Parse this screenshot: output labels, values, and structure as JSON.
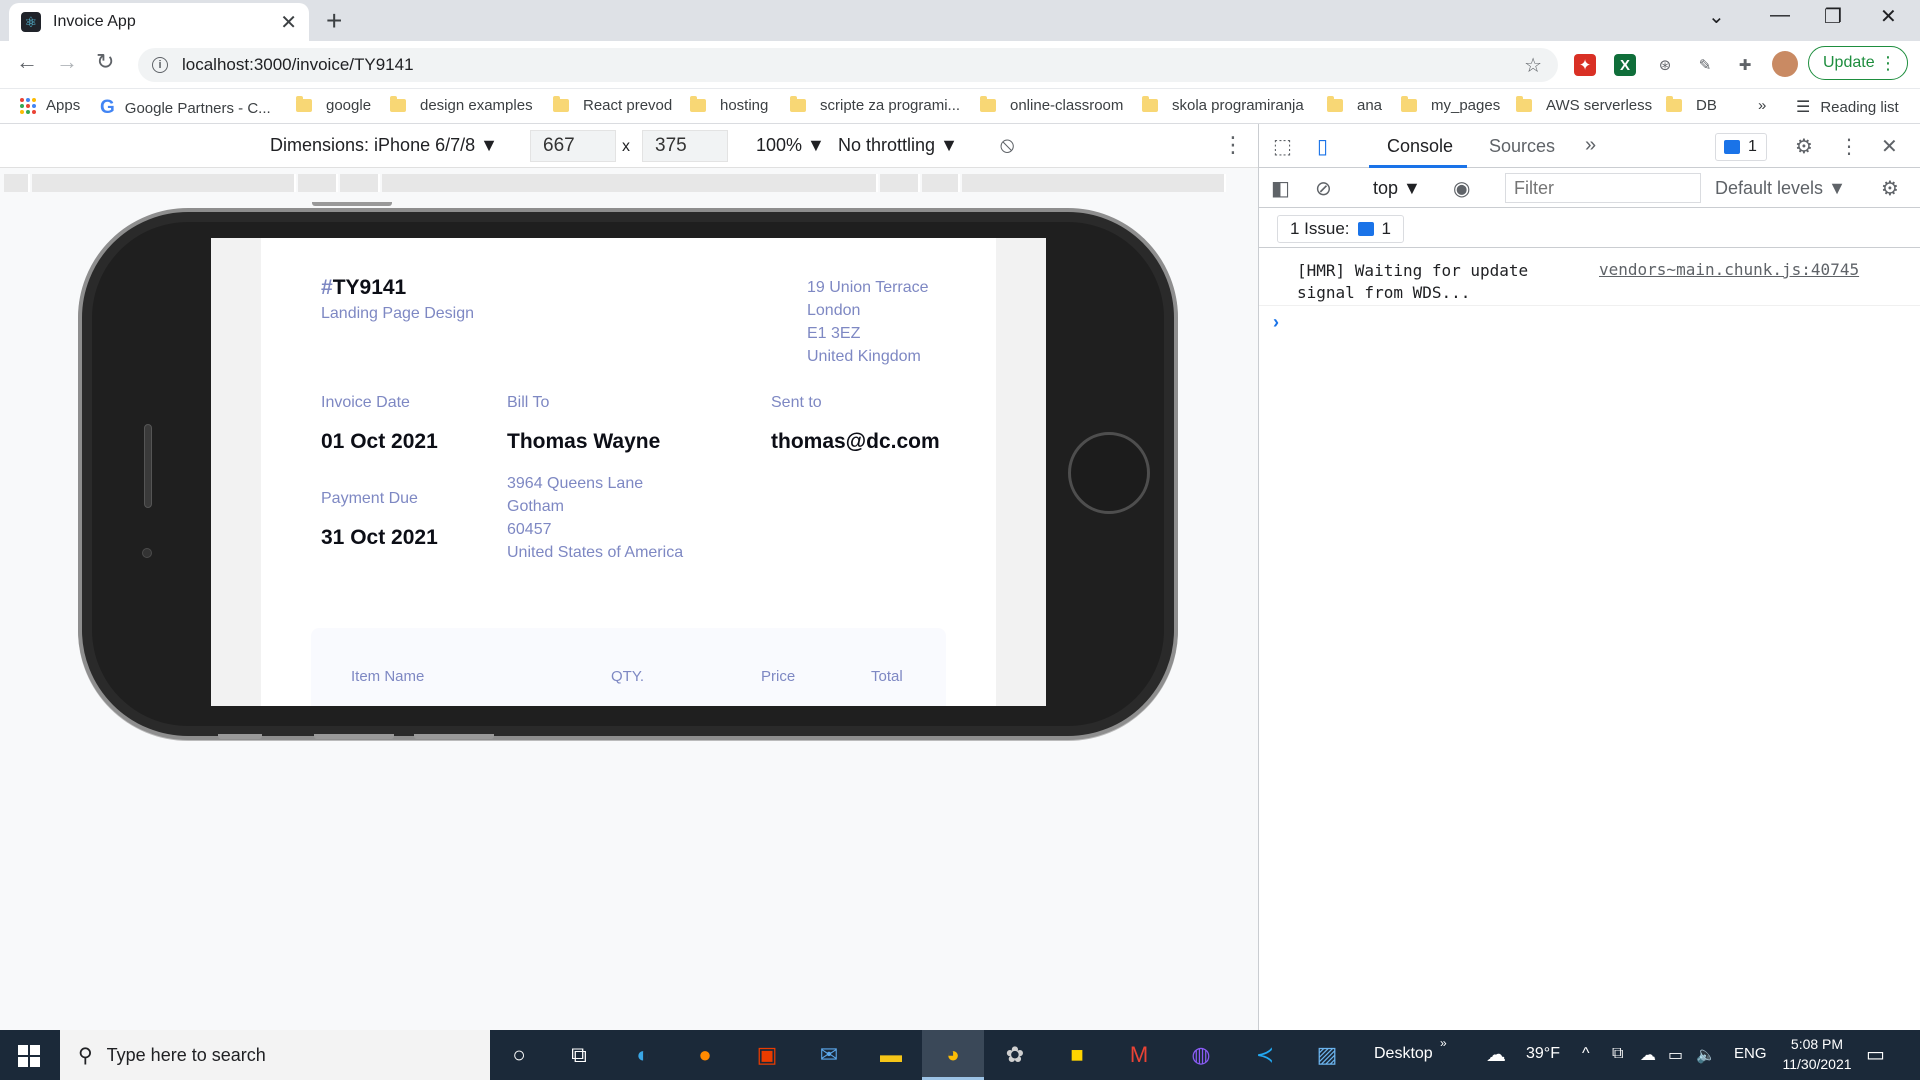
{
  "browser": {
    "tab_title": "Invoice App",
    "url": "localhost:3000/invoice/TY9141",
    "update_label": "Update"
  },
  "bookmarks": [
    {
      "label": "Apps",
      "icon": "apps-grid-icon"
    },
    {
      "label": "Google Partners - C...",
      "icon": "google-icon"
    },
    {
      "label": "google",
      "icon": "folder-icon"
    },
    {
      "label": "design examples",
      "icon": "folder-icon"
    },
    {
      "label": "React prevod",
      "icon": "folder-icon"
    },
    {
      "label": "hosting",
      "icon": "folder-icon"
    },
    {
      "label": "scripte za programi...",
      "icon": "folder-icon"
    },
    {
      "label": "online-classroom",
      "icon": "folder-icon"
    },
    {
      "label": "skola programiranja",
      "icon": "folder-icon"
    },
    {
      "label": "ana",
      "icon": "folder-icon"
    },
    {
      "label": "my_pages",
      "icon": "folder-icon"
    },
    {
      "label": "AWS serverless",
      "icon": "folder-icon"
    },
    {
      "label": "DB",
      "icon": "folder-icon"
    }
  ],
  "reading_list": "Reading list",
  "device_toolbar": {
    "dimensions": "Dimensions: iPhone 6/7/8",
    "width": "667",
    "times": "x",
    "height": "375",
    "zoom": "100%",
    "throttling": "No throttling"
  },
  "invoice": {
    "hash": "#",
    "id": "TY9141",
    "description": "Landing Page Design",
    "sender_address": [
      "19 Union Terrace",
      "London",
      "E1 3EZ",
      "United Kingdom"
    ],
    "invoice_date_label": "Invoice Date",
    "invoice_date": "01 Oct 2021",
    "payment_due_label": "Payment Due",
    "payment_due": "31 Oct 2021",
    "bill_to_label": "Bill To",
    "client_name": "Thomas Wayne",
    "client_address": [
      "3964 Queens Lane",
      "Gotham",
      "60457",
      "United States of America"
    ],
    "sent_to_label": "Sent to",
    "client_email": "thomas@dc.com",
    "items_headers": [
      "Item Name",
      "QTY.",
      "Price",
      "Total"
    ]
  },
  "devtools": {
    "tabs": [
      "Console",
      "Sources"
    ],
    "messages_count": "1",
    "context": "top",
    "filter_placeholder": "Filter",
    "levels": "Default levels",
    "issues": "1 Issue:",
    "issues_count": "1",
    "console_message": "[HMR] Waiting for update signal from WDS...",
    "console_source": "vendors~main.chunk.js:40745"
  },
  "taskbar": {
    "search_placeholder": "Type here to search",
    "desktop_label": "Desktop",
    "weather": "39°F",
    "language": "ENG",
    "time": "5:08 PM",
    "date": "11/30/2021"
  },
  "colors": {
    "accent_purple": "#7e88c3",
    "text_dark": "#0c0e16",
    "devtools_blue": "#1a73e8",
    "taskbar_bg": "#1b2939"
  }
}
